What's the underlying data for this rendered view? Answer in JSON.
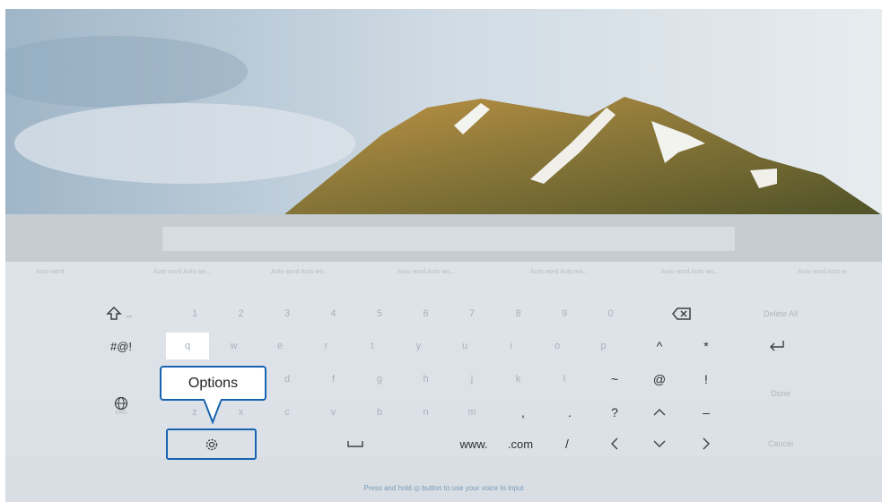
{
  "suggestions": [
    "Auto word",
    "Auto word Auto wo...",
    "Auto word Auto wo...",
    "Auto word Auto wo...",
    "Auto word Auto wo...",
    "Auto word Auto wo...",
    "Auto word Auto w"
  ],
  "keyboard": {
    "number_row": [
      "1",
      "2",
      "3",
      "4",
      "5",
      "6",
      "7",
      "8",
      "9",
      "0"
    ],
    "letter_row_1": [
      "q",
      "w",
      "e",
      "r",
      "t",
      "y",
      "u",
      "i",
      "o",
      "p"
    ],
    "letter_row_2": [
      "d",
      "f",
      "g",
      "h",
      "j",
      "k",
      "l"
    ],
    "letter_row_3": [
      "z",
      "x",
      "c",
      "v",
      "b",
      "n",
      "m"
    ],
    "symbols_label": "#@!",
    "lang_label": "ENG",
    "punct_rows": {
      "r2": [
        "^",
        "*"
      ],
      "r3": [
        "~",
        "@",
        "!"
      ],
      "r4": [
        ",",
        ".",
        "?"
      ],
      "r5": [
        "www.",
        ".com",
        "/"
      ]
    },
    "delete_all": "Delete All",
    "done": "Done",
    "cancel": "Cancel"
  },
  "tooltip": {
    "label": "Options"
  },
  "hint_text": "Press and hold ◎ button to use your voice to input",
  "colors": {
    "focus_border": "#1763b1"
  }
}
